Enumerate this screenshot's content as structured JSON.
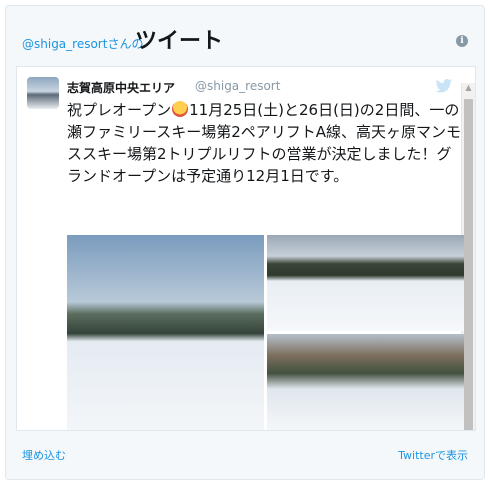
{
  "header": {
    "handle": "@shiga_resort",
    "handle_suffix": "さんの",
    "title": "ツイート",
    "info_icon": "i"
  },
  "tweet": {
    "name": "志賀高原中央エリア",
    "screen_name": "@shiga_resort",
    "text_before_emoji": "祝プレオープン",
    "text_after_emoji": "11月25日(土)と26日(日)の2日間、一の瀬ファミリースキー場第2ペアリフトA線、高天ヶ原マンモススキー場第2トリプルリフトの営業が決定しました！グランドオープンは予定通り12月1日です。"
  },
  "footer": {
    "embed_label": "埋め込む",
    "view_label": "Twitterで表示"
  },
  "icons": {
    "bird": "twitter-bird-icon",
    "info": "info-icon"
  },
  "colors": {
    "link": "#1b95e0",
    "text": "#14171a",
    "muted": "#8899a6"
  }
}
